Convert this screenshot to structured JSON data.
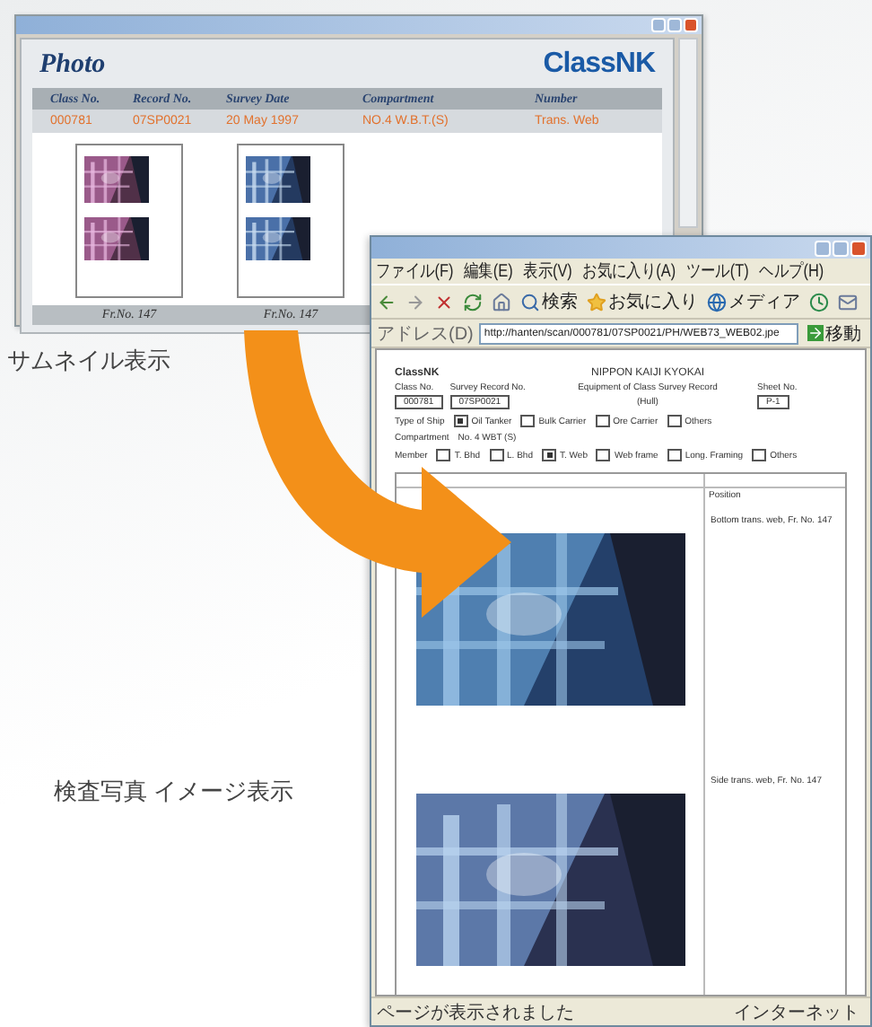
{
  "thumbnail_window": {
    "title": "Photo",
    "logo": "ClassNK",
    "columns": [
      "Class No.",
      "Record No.",
      "Survey Date",
      "Compartment",
      "Number"
    ],
    "row": [
      "000781",
      "07SP0021",
      "20 May 1997",
      "NO.4 W.B.T.(S)",
      "Trans. Web"
    ],
    "thumbnails": [
      {
        "caption": "Fr.No. 147"
      },
      {
        "caption": "Fr.No. 147"
      }
    ]
  },
  "thumbnail_label": "サムネイル表示",
  "browser": {
    "menu": [
      "ファイル(F)",
      "編集(E)",
      "表示(V)",
      "お気に入り(A)",
      "ツール(T)",
      "ヘルプ(H)"
    ],
    "search": "検索",
    "favorites": "お気に入り",
    "media": "メディア",
    "address_label": "アドレス(D)",
    "url": "http://hanten/scan/000781/07SP0021/PH/WEB73_WEB02.jpe",
    "go": "移動",
    "document": {
      "logo": "ClassNK",
      "org": "NIPPON KAIJI KYOKAI",
      "record": "Equipment of Class Survey Record",
      "part": "(Hull)",
      "fields": [
        {
          "label": "Class No.",
          "value": "000781"
        },
        {
          "label": "Survey Record No.",
          "value": "07SP0021"
        }
      ],
      "sheet": {
        "label": "Sheet No.",
        "value": "P-1"
      },
      "ship_label": "Type of Ship",
      "ship_types": [
        {
          "label": "Oil Tanker",
          "checked": true
        },
        {
          "label": "Bulk Carrier",
          "checked": false
        },
        {
          "label": "Ore Carrier",
          "checked": false
        },
        {
          "label": "Others",
          "checked": false
        }
      ],
      "compartment_label": "Compartment",
      "compartment": "No. 4 WBT (S)",
      "member_label": "Member",
      "members": [
        {
          "label": "T. Bhd",
          "checked": false
        },
        {
          "label": "L. Bhd",
          "checked": false
        },
        {
          "label": "T. Web",
          "checked": true
        },
        {
          "label": "Web frame",
          "checked": false
        },
        {
          "label": "Long. Framing",
          "checked": false
        },
        {
          "label": "Others",
          "checked": false
        }
      ],
      "position_heading": "Position",
      "photos": [
        {
          "caption": "Bottom trans. web, Fr. No. 147"
        },
        {
          "caption": "Side trans. web, Fr. No. 147"
        }
      ]
    },
    "status": "ページが表示されました",
    "zone": "インターネット"
  },
  "image_label": "検査写真 イメージ表示"
}
